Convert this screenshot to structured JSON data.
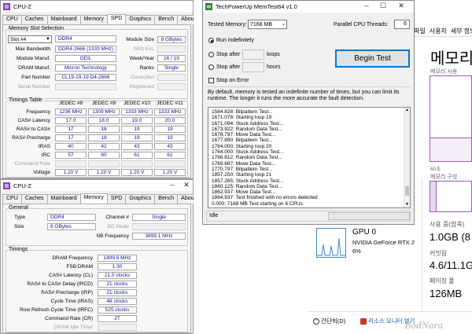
{
  "cpuz1": {
    "title": "CPU-Z",
    "tabs": [
      "CPU",
      "Caches",
      "Mainboard",
      "Memory",
      "SPD",
      "Graphics",
      "Bench",
      "About"
    ],
    "active_tab": "SPD",
    "slot_group": "Memory Slot Selection",
    "slot_value": "Slot #4",
    "ddr": "DDR4",
    "rows_left": [
      {
        "label": "Max Bandwidth",
        "value": "DDR4-2666 (1333 MHz)"
      },
      {
        "label": "Module Manuf.",
        "value": "GEIL"
      },
      {
        "label": "DRAM Manuf.",
        "value": "Micron Technology"
      },
      {
        "label": "Part Number",
        "value": "CL19-19-19 D4-2666"
      },
      {
        "label": "Serial Number",
        "value": ""
      }
    ],
    "rows_right": [
      {
        "label": "Module Size",
        "value": "8 GBytes"
      },
      {
        "label": "SPD Ext.",
        "value": ""
      },
      {
        "label": "Week/Year",
        "value": "16 / 19"
      },
      {
        "label": "Ranks",
        "value": "Single"
      },
      {
        "label": "Correction",
        "value": ""
      },
      {
        "label": "Registered",
        "value": ""
      }
    ],
    "timings_group": "Timings Table",
    "timing_headers": [
      "JEDEC #8",
      "JEDEC #9",
      "JEDEC #10",
      "JEDEC #11"
    ],
    "timings": [
      {
        "label": "Frequency",
        "values": [
          "1236 MHz",
          "1309 MHz",
          "1333 MHz",
          "1333 MHz"
        ]
      },
      {
        "label": "CAS# Latency",
        "values": [
          "17.0",
          "18.0",
          "19.0",
          "20.0"
        ]
      },
      {
        "label": "RAS# to CAS#",
        "values": [
          "17",
          "18",
          "19",
          "19"
        ]
      },
      {
        "label": "RAS# Precharge",
        "values": [
          "17",
          "18",
          "19",
          "19"
        ]
      },
      {
        "label": "tRAS",
        "values": [
          "40",
          "42",
          "43",
          "43"
        ]
      },
      {
        "label": "tRC",
        "values": [
          "57",
          "60",
          "61",
          "61"
        ]
      },
      {
        "label": "Command Rate",
        "values": [
          "",
          "",
          "",
          ""
        ]
      },
      {
        "label": "Voltage",
        "values": [
          "1.20 V",
          "1.20 V",
          "1.20 V",
          "1.20 V"
        ]
      }
    ]
  },
  "cpuz2": {
    "title": "CPU-Z",
    "tabs": [
      "CPU",
      "Caches",
      "Mainboard",
      "Memory",
      "SPD",
      "Graphics",
      "Bench",
      "About"
    ],
    "active_tab": "Memory",
    "general_group": "General",
    "type_label": "Type",
    "type_value": "DDR4",
    "size_label": "Size",
    "size_value": "8 GBytes",
    "channel_label": "Channel #",
    "channel_value": "Single",
    "dc_label": "DC Mode",
    "dc_value": "",
    "nb_label": "NB Frequency",
    "nb_value": "3899.1 MHz",
    "timings_group": "Timings",
    "timings": [
      {
        "label": "DRAM Frequency",
        "value": "1499.6 MHz"
      },
      {
        "label": "FSB:DRAM",
        "value": "1:30"
      },
      {
        "label": "CAS# Latency (CL)",
        "value": "21.0 clocks"
      },
      {
        "label": "RAS# to CAS# Delay (tRCD)",
        "value": "21 clocks"
      },
      {
        "label": "RAS# Precharge (tRP)",
        "value": "21 clocks"
      },
      {
        "label": "Cycle Time (tRAS)",
        "value": "48 clocks"
      },
      {
        "label": "Row Refresh Cycle Time (tRFC)",
        "value": "525 clocks"
      },
      {
        "label": "Command Rate (CR)",
        "value": "2T"
      },
      {
        "label": "DRAM Idle Timer",
        "value": ""
      }
    ]
  },
  "memtest": {
    "title": "TechPowerUp MemTest64 v1.0",
    "tested_label": "Tested Memory:",
    "tested_value": "7168 MB",
    "threads_label": "Parallel CPU Threads:",
    "threads_value": "6",
    "run_indef": "Run indefinitely",
    "stop_after": "Stop after",
    "loops": "loops",
    "hours": "hours",
    "stop_error": "Stop on Error",
    "begin": "Begin Test",
    "desc": "By default, memory is tested an indefinite number of times, but you can limit its runtime. The longer it runs the more accurate the fault detection.",
    "log": [
      "1584.828: Bitpattern Test...",
      "1671.078: Starting loop 19",
      "1671.094: Stuck Address Test...",
      "1673.922: Random Data Test...",
      "1676.797: Move Data Test...",
      "1677.890: Bitpattern Test...",
      "1764.000: Starting loop 20",
      "1764.000: Stuck Address Test...",
      "1766.812: Random Data Test...",
      "1769.687: Move Data Test...",
      "1770.797: Bitpattern Test...",
      "1857.250: Starting loop 21",
      "1857.265: Stuck Address Test...",
      "1860.125: Random Data Test...",
      "1862.937: Move Data Test...",
      "1864.937: Test finished with no errors detected",
      "0.000: 7168 MB Test starting on 6 CPUs"
    ],
    "status": "Idle"
  },
  "taskmgr": {
    "menu": [
      "파일",
      "사용자",
      "세부 정보",
      "서"
    ],
    "mem_title": "메모리",
    "mem_usage": "메모리 사용",
    "time_label": "60초",
    "composition": "메모리 구성",
    "gpu_title": "GPU 0",
    "gpu_name": "NVIDIA GeForce RTX 2",
    "gpu_pct": "6%",
    "used_label": "사용 중(압축)",
    "used_value": "1.0GB (8",
    "commit_label": "커밋됨",
    "commit_value": "4.6/11.1G",
    "paged_label": "페이징 풀",
    "paged_value": "126MB",
    "simple": "간단히(D)",
    "monitor": "리소스 모니터 열기"
  },
  "watermark": "BodNara"
}
